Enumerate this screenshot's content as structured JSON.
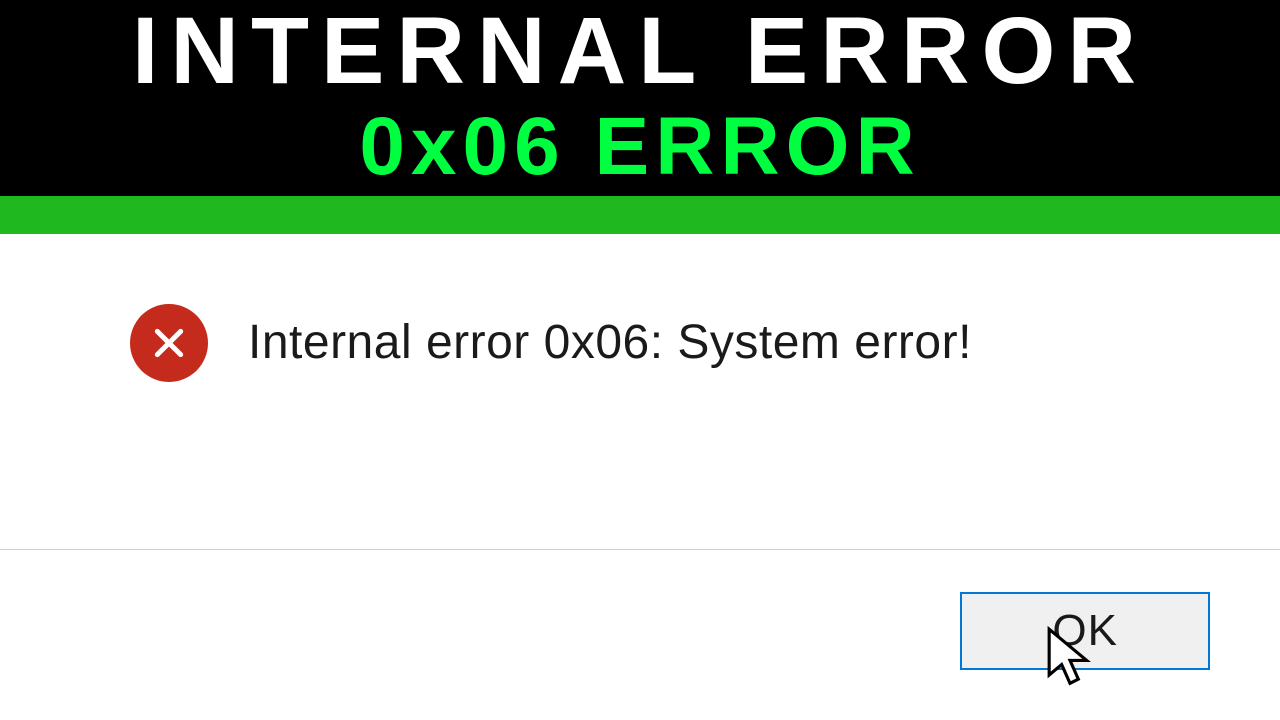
{
  "header": {
    "line1": "INTERNAL ERROR",
    "line2": "0x06 ERROR"
  },
  "dialog": {
    "message": "Internal error 0x06: System error!",
    "ok_label": "OK"
  },
  "colors": {
    "accent_green": "#00ff41",
    "stripe_green": "#1fb91f",
    "error_red": "#c42b1c",
    "button_border": "#0078d7"
  }
}
